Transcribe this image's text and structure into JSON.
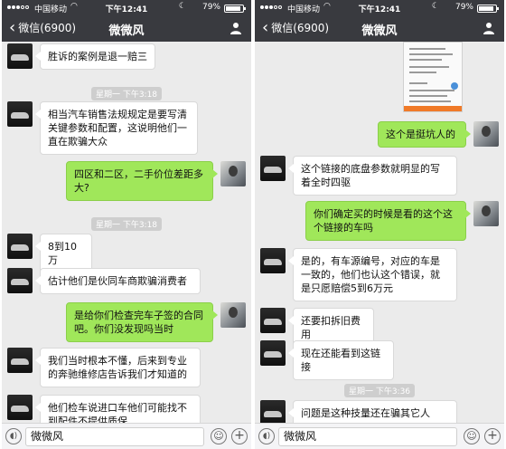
{
  "status_bar": {
    "carrier": "中国移动",
    "time": "下午12:41",
    "battery_pct": "79%",
    "battery_level": 0.79
  },
  "nav": {
    "back_label": "微信(6900)",
    "title": "微微风"
  },
  "input_bar": {
    "text": "微微风"
  },
  "left_chat": {
    "m1": "胜诉的案例是退一赔三",
    "ts1": "星期一 下午3:18",
    "m2": "相当汽车销售法规规定是要写清关键参数和配置，这说明他们一直在欺骗大众",
    "m3": "四区和二区，二手价位差距多大?",
    "ts2": "星期一 下午3:18",
    "m4": "8到10万",
    "m5": "估计他们是伙同车商欺骗消费者",
    "m6": "是给你们检查完车子签的合同吧。你们没发现吗当时",
    "m7": "我们当时根本不懂，后来到专业的奔驰维修店告诉我们才知道的",
    "m8": "他们检车说进口车他们可能找不到配件不提供质保"
  },
  "right_chat": {
    "m1": "这个是挺坑人的",
    "m2": "这个链接的底盘参数就明显的写着全时四驱",
    "m3": "你们确定买的时候是看的这个这个链接的车吗",
    "m4": "是的，有车源编号，对应的车是一致的，他们也认这个错误，就是只愿赔偿5到6万元",
    "m5": "还要扣拆旧费用",
    "m6": "现在还能看到这链接",
    "ts1": "星期一 下午3:36",
    "m7": "问题是这种技量还在骗其它人"
  },
  "icons": [
    "back-chevron-icon",
    "person-icon",
    "voice-icon",
    "emoji-icon",
    "plus-icon",
    "wifi-icon",
    "moon-icon",
    "battery-icon"
  ],
  "colors": {
    "nav_bg": "#393a3f",
    "chat_bg": "#ebebeb",
    "sent_bubble": "#a0e75a",
    "received_bubble": "#ffffff"
  }
}
